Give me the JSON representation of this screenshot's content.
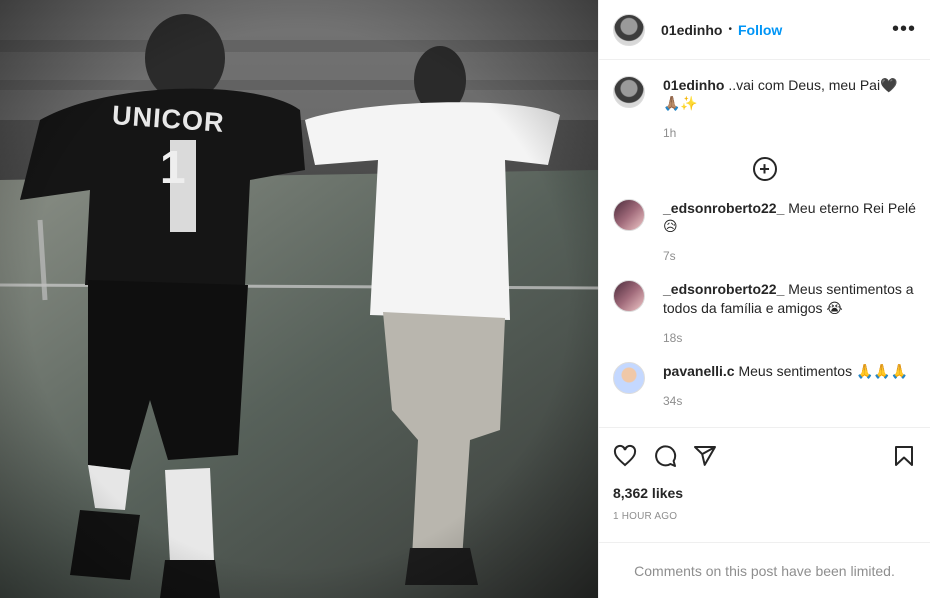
{
  "post": {
    "username": "01edinho",
    "follow_label": "Follow",
    "separator": "•",
    "more_label": "•••",
    "photo": {
      "jersey_text": "UNICOR",
      "jersey_number": "1"
    },
    "caption": {
      "username": "01edinho",
      "text": " ..vai com Deus, meu Pai🖤",
      "emoji_line": "🙏🏽✨",
      "time": "1h"
    },
    "add_label": "+",
    "comments": [
      {
        "username": "_edsonroberto22_",
        "text": " Meu eterno Rei Pelé",
        "emoji": "😥",
        "time": "7s"
      },
      {
        "username": "_edsonroberto22_",
        "text": " Meus sentimentos a todos da família e amigos",
        "emoji": "😭",
        "time": "18s"
      },
      {
        "username": "pavanelli.c",
        "text": " Meus sentimentos",
        "emoji": "🙏🙏🙏",
        "time": "34s"
      }
    ],
    "likes": "8,362 likes",
    "posted": "1 HOUR AGO",
    "limited_notice": "Comments on this post have been limited."
  },
  "icons": [
    "heart-icon",
    "comment-icon",
    "share-icon",
    "bookmark-icon",
    "add-circle-icon",
    "more-icon"
  ],
  "colors": {
    "accent": "#0095f6",
    "muted": "#8e8e8e",
    "text": "#262626",
    "border": "#efefef"
  }
}
